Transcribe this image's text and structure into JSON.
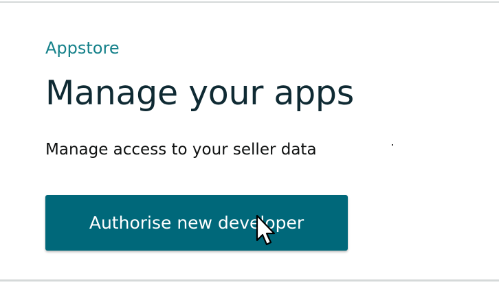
{
  "header": {
    "eyebrow": "Appstore",
    "title": "Manage your apps",
    "subtitle": "Manage access to your seller data"
  },
  "actions": {
    "primary_label": "Authorise new developer"
  },
  "colors": {
    "accent": "#15818a",
    "button": "#00687a",
    "title": "#0f2a33"
  },
  "icons": {
    "pointer": "mouse-pointer-icon"
  }
}
